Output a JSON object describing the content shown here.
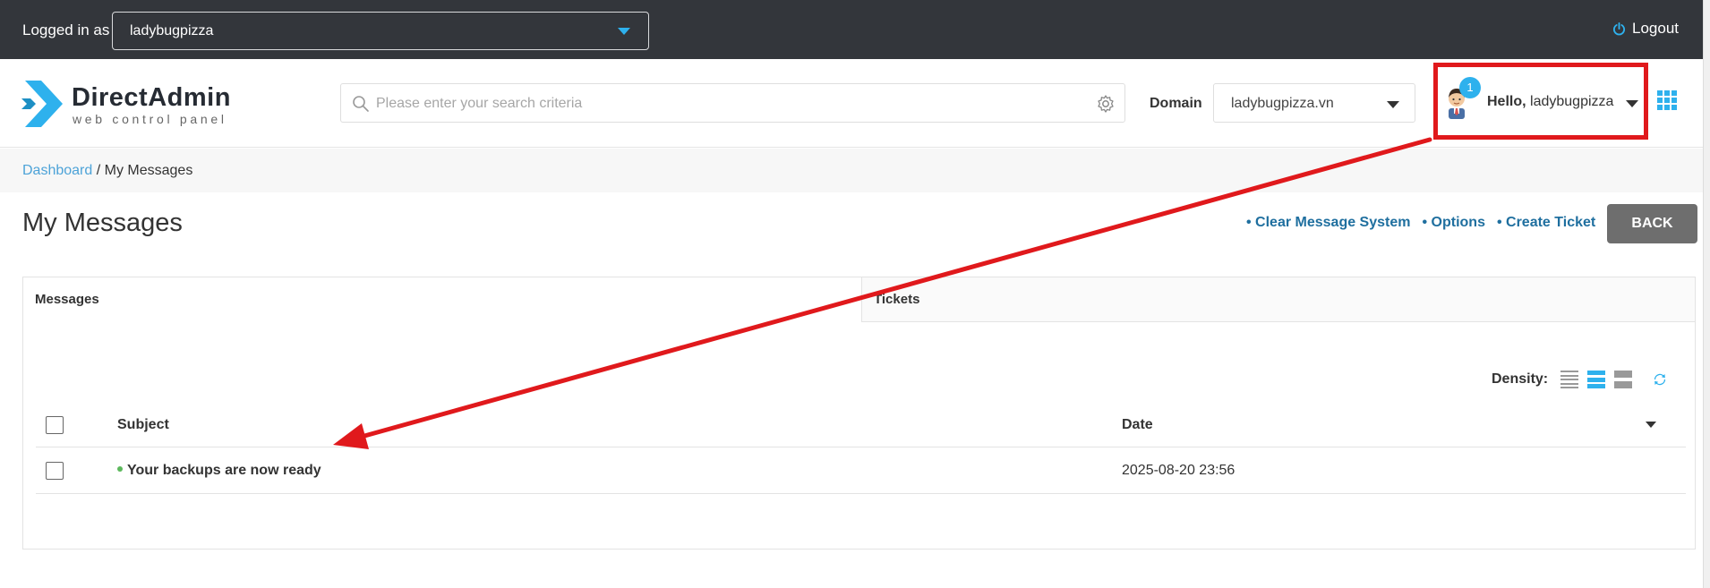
{
  "topbar": {
    "logged_in_label": "Logged in as",
    "user_value": "ladybugpizza",
    "logout_label": "Logout"
  },
  "header": {
    "logo_title": "DirectAdmin",
    "logo_subtitle": "web control panel",
    "search_placeholder": "Please enter your search criteria",
    "domain_label": "Domain",
    "domain_value": "ladybugpizza.vn",
    "notification_count": "1",
    "hello_prefix": "Hello,",
    "hello_user": "ladybugpizza"
  },
  "breadcrumb": {
    "dashboard": "Dashboard",
    "separator": " / ",
    "current": "My Messages"
  },
  "page": {
    "title": "My Messages",
    "actions": [
      "• Clear Message System",
      "• Options",
      "• Create Ticket"
    ],
    "back_label": "BACK"
  },
  "tabs": {
    "messages": "Messages",
    "tickets": "Tickets"
  },
  "table": {
    "density_label": "Density:",
    "columns": {
      "subject": "Subject",
      "date": "Date"
    },
    "rows": [
      {
        "subject": "Your backups are now ready",
        "date": "2025-08-20 23:56"
      }
    ]
  },
  "colors": {
    "accent": "#2eb1ed",
    "topbar": "#33363b",
    "annotation": "#e0191c",
    "unread_dot": "#5cb85c"
  }
}
